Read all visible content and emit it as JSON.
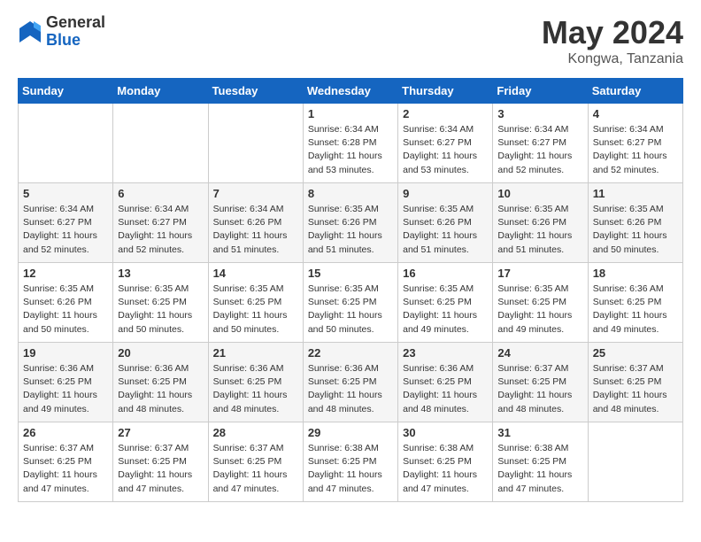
{
  "header": {
    "logo_general": "General",
    "logo_blue": "Blue",
    "month_title": "May 2024",
    "location": "Kongwa, Tanzania"
  },
  "days_of_week": [
    "Sunday",
    "Monday",
    "Tuesday",
    "Wednesday",
    "Thursday",
    "Friday",
    "Saturday"
  ],
  "weeks": [
    [
      {
        "day": "",
        "info": ""
      },
      {
        "day": "",
        "info": ""
      },
      {
        "day": "",
        "info": ""
      },
      {
        "day": "1",
        "info": "Sunrise: 6:34 AM\nSunset: 6:28 PM\nDaylight: 11 hours\nand 53 minutes."
      },
      {
        "day": "2",
        "info": "Sunrise: 6:34 AM\nSunset: 6:27 PM\nDaylight: 11 hours\nand 53 minutes."
      },
      {
        "day": "3",
        "info": "Sunrise: 6:34 AM\nSunset: 6:27 PM\nDaylight: 11 hours\nand 52 minutes."
      },
      {
        "day": "4",
        "info": "Sunrise: 6:34 AM\nSunset: 6:27 PM\nDaylight: 11 hours\nand 52 minutes."
      }
    ],
    [
      {
        "day": "5",
        "info": "Sunrise: 6:34 AM\nSunset: 6:27 PM\nDaylight: 11 hours\nand 52 minutes."
      },
      {
        "day": "6",
        "info": "Sunrise: 6:34 AM\nSunset: 6:27 PM\nDaylight: 11 hours\nand 52 minutes."
      },
      {
        "day": "7",
        "info": "Sunrise: 6:34 AM\nSunset: 6:26 PM\nDaylight: 11 hours\nand 51 minutes."
      },
      {
        "day": "8",
        "info": "Sunrise: 6:35 AM\nSunset: 6:26 PM\nDaylight: 11 hours\nand 51 minutes."
      },
      {
        "day": "9",
        "info": "Sunrise: 6:35 AM\nSunset: 6:26 PM\nDaylight: 11 hours\nand 51 minutes."
      },
      {
        "day": "10",
        "info": "Sunrise: 6:35 AM\nSunset: 6:26 PM\nDaylight: 11 hours\nand 51 minutes."
      },
      {
        "day": "11",
        "info": "Sunrise: 6:35 AM\nSunset: 6:26 PM\nDaylight: 11 hours\nand 50 minutes."
      }
    ],
    [
      {
        "day": "12",
        "info": "Sunrise: 6:35 AM\nSunset: 6:26 PM\nDaylight: 11 hours\nand 50 minutes."
      },
      {
        "day": "13",
        "info": "Sunrise: 6:35 AM\nSunset: 6:25 PM\nDaylight: 11 hours\nand 50 minutes."
      },
      {
        "day": "14",
        "info": "Sunrise: 6:35 AM\nSunset: 6:25 PM\nDaylight: 11 hours\nand 50 minutes."
      },
      {
        "day": "15",
        "info": "Sunrise: 6:35 AM\nSunset: 6:25 PM\nDaylight: 11 hours\nand 50 minutes."
      },
      {
        "day": "16",
        "info": "Sunrise: 6:35 AM\nSunset: 6:25 PM\nDaylight: 11 hours\nand 49 minutes."
      },
      {
        "day": "17",
        "info": "Sunrise: 6:35 AM\nSunset: 6:25 PM\nDaylight: 11 hours\nand 49 minutes."
      },
      {
        "day": "18",
        "info": "Sunrise: 6:36 AM\nSunset: 6:25 PM\nDaylight: 11 hours\nand 49 minutes."
      }
    ],
    [
      {
        "day": "19",
        "info": "Sunrise: 6:36 AM\nSunset: 6:25 PM\nDaylight: 11 hours\nand 49 minutes."
      },
      {
        "day": "20",
        "info": "Sunrise: 6:36 AM\nSunset: 6:25 PM\nDaylight: 11 hours\nand 48 minutes."
      },
      {
        "day": "21",
        "info": "Sunrise: 6:36 AM\nSunset: 6:25 PM\nDaylight: 11 hours\nand 48 minutes."
      },
      {
        "day": "22",
        "info": "Sunrise: 6:36 AM\nSunset: 6:25 PM\nDaylight: 11 hours\nand 48 minutes."
      },
      {
        "day": "23",
        "info": "Sunrise: 6:36 AM\nSunset: 6:25 PM\nDaylight: 11 hours\nand 48 minutes."
      },
      {
        "day": "24",
        "info": "Sunrise: 6:37 AM\nSunset: 6:25 PM\nDaylight: 11 hours\nand 48 minutes."
      },
      {
        "day": "25",
        "info": "Sunrise: 6:37 AM\nSunset: 6:25 PM\nDaylight: 11 hours\nand 48 minutes."
      }
    ],
    [
      {
        "day": "26",
        "info": "Sunrise: 6:37 AM\nSunset: 6:25 PM\nDaylight: 11 hours\nand 47 minutes."
      },
      {
        "day": "27",
        "info": "Sunrise: 6:37 AM\nSunset: 6:25 PM\nDaylight: 11 hours\nand 47 minutes."
      },
      {
        "day": "28",
        "info": "Sunrise: 6:37 AM\nSunset: 6:25 PM\nDaylight: 11 hours\nand 47 minutes."
      },
      {
        "day": "29",
        "info": "Sunrise: 6:38 AM\nSunset: 6:25 PM\nDaylight: 11 hours\nand 47 minutes."
      },
      {
        "day": "30",
        "info": "Sunrise: 6:38 AM\nSunset: 6:25 PM\nDaylight: 11 hours\nand 47 minutes."
      },
      {
        "day": "31",
        "info": "Sunrise: 6:38 AM\nSunset: 6:25 PM\nDaylight: 11 hours\nand 47 minutes."
      },
      {
        "day": "",
        "info": ""
      }
    ]
  ]
}
